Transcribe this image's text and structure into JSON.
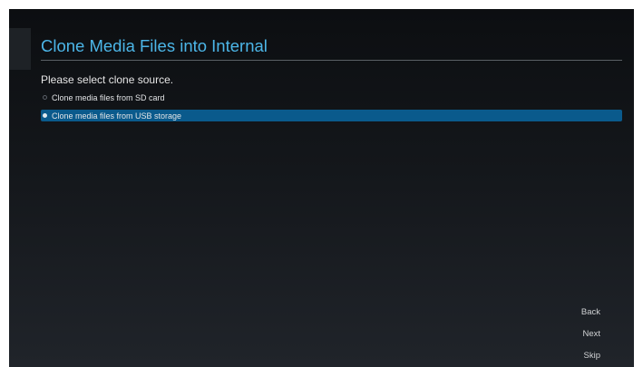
{
  "window": {
    "title": "Clone Media Files into Internal"
  },
  "prompt": "Please select clone source.",
  "options": [
    {
      "label": "Clone media files from SD card",
      "selected": false
    },
    {
      "label": "Clone media files from USB storage",
      "selected": true
    }
  ],
  "nav": {
    "back": "Back",
    "next": "Next",
    "skip": "Skip"
  },
  "colors": {
    "title": "#4cb6e8",
    "selection": "#0a5a8c"
  }
}
